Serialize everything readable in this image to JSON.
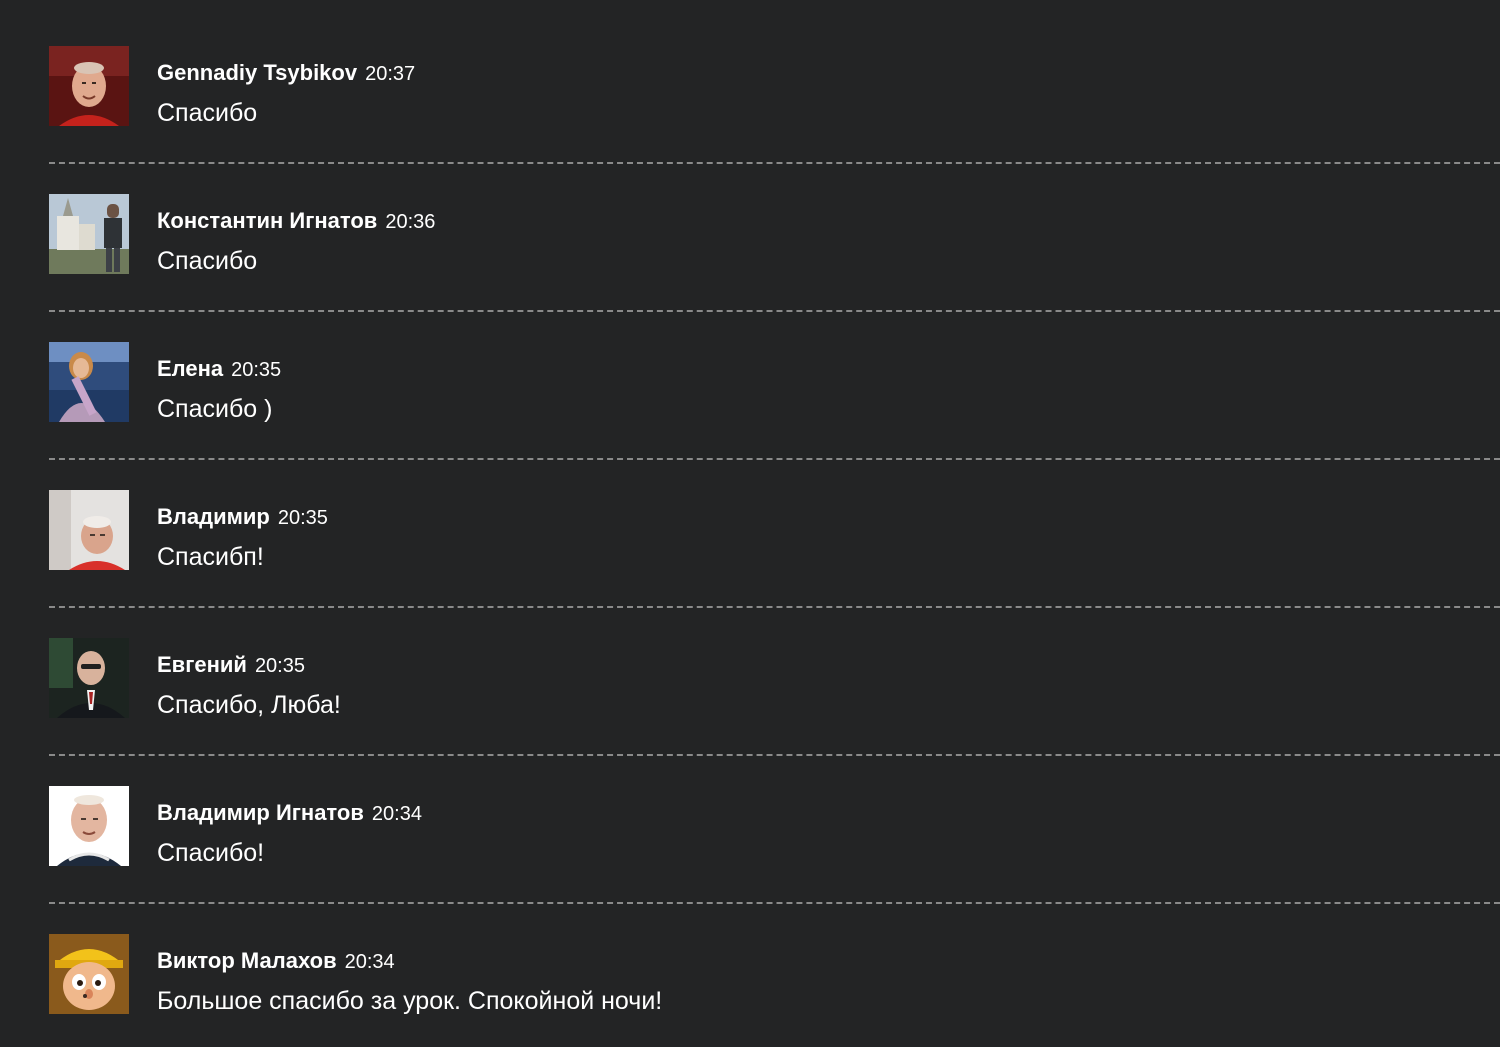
{
  "messages": [
    {
      "author": "Gennadiy Tsybikov",
      "time": "20:37",
      "text": "Спасибо",
      "avatar": "avatar-man-red-shirt"
    },
    {
      "author": "Константин Игнатов",
      "time": "20:36",
      "text": "Спасибо",
      "avatar": "avatar-man-church"
    },
    {
      "author": "Елена",
      "time": "20:35",
      "text": "Спасибо )",
      "avatar": "avatar-woman-scarf"
    },
    {
      "author": "Владимир",
      "time": "20:35",
      "text": "Спасибп!",
      "avatar": "avatar-man-indoor"
    },
    {
      "author": "Евгений",
      "time": "20:35",
      "text": "Спасибо, Люба!",
      "avatar": "avatar-man-suit"
    },
    {
      "author": "Владимир Игнатов",
      "time": "20:34",
      "text": "Спасибо!",
      "avatar": "avatar-man-white-bg"
    },
    {
      "author": "Виктор Малахов",
      "time": "20:34",
      "text": "Большое спасибо за урок. Спокойной ночи!",
      "avatar": "avatar-cartoon-boy"
    }
  ],
  "colors": {
    "background": "#232425",
    "text": "#ffffff",
    "separator": "#8a8a8a"
  }
}
